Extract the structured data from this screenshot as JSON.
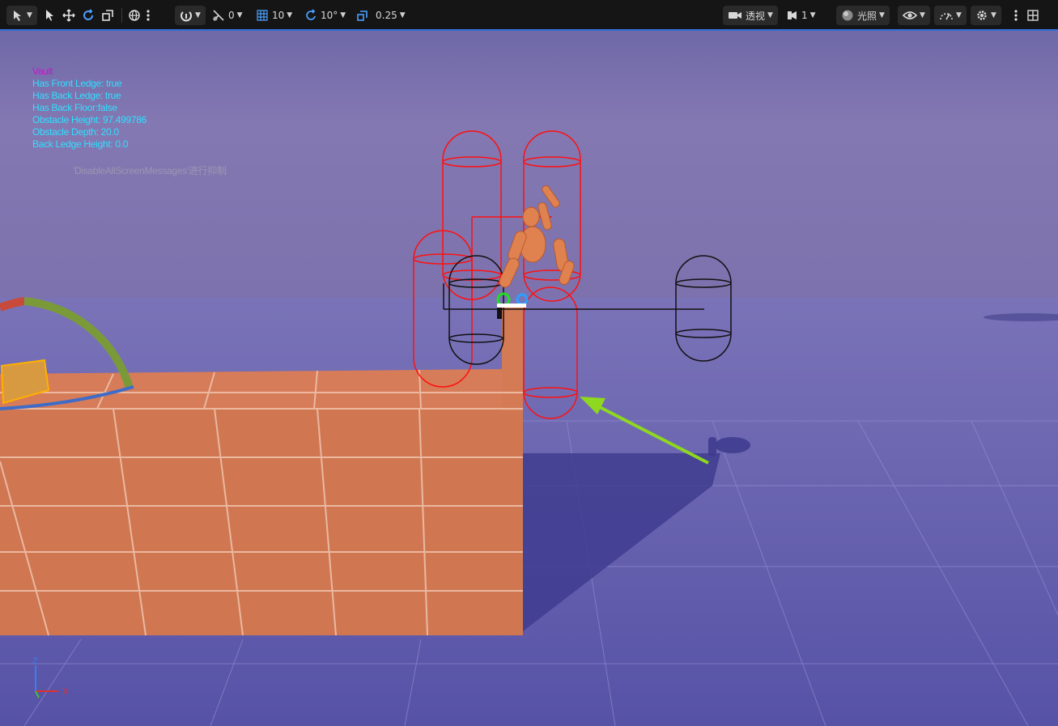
{
  "toolbar": {
    "select_mode_icon": "select-mode-icon",
    "tools": [
      "select-arrow-icon",
      "move-icon",
      "rotate-icon",
      "scale-icon"
    ],
    "coord_icon": "globe-icon",
    "surface_snap_icon": "surface-snap-icon",
    "angle_snap_value": "0",
    "grid_snap_value": "10",
    "rotation_snap_value": "10°",
    "scale_snap_value": "0.25",
    "view_mode_label": "透视",
    "camera_speed_value": "1",
    "lighting_label": "光照",
    "accent_color": "#2f6fd6"
  },
  "debug": {
    "title": "Vault",
    "lines": [
      "Has Front Ledge: true",
      "Has Back Ledge: true",
      "Has Back Floor:false",
      "Obstacle Height: 97.499786",
      "Obstacle Depth: 20.0",
      "Back Ledge Height: 0.0"
    ],
    "title_color": "#cc10cc",
    "line_color": "#2ee0ff"
  },
  "suppress_message": "'DisableAllScreenMessages'进行抑制",
  "axis": {
    "z_label": "Z",
    "x_label": "X"
  }
}
